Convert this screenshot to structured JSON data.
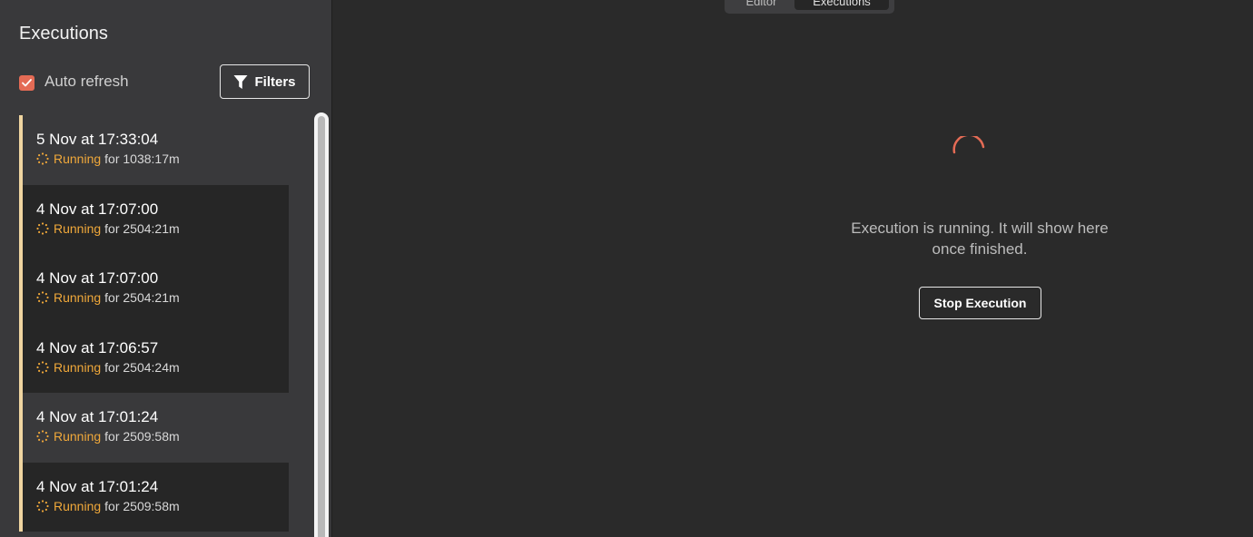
{
  "colors": {
    "accent": "#e46b55",
    "running": "#f0a83a",
    "running_bar": "#f0d5a0",
    "sidebar_bg": "#39393b",
    "main_bg": "#2a2a2a"
  },
  "header": {
    "tabs": [
      {
        "label": "Editor",
        "active": false
      },
      {
        "label": "Executions",
        "active": true
      }
    ]
  },
  "sidebar": {
    "title": "Executions",
    "auto_refresh": {
      "label": "Auto refresh",
      "checked": true
    },
    "filters_button": {
      "label": "Filters",
      "icon": "filter-icon"
    },
    "items": [
      {
        "title": "5 Nov at 17:33:04",
        "status": "Running",
        "duration": "for 1038:17m",
        "highlighted": true
      },
      {
        "title": "4 Nov at 17:07:00",
        "status": "Running",
        "duration": "for 2504:21m",
        "highlighted": false
      },
      {
        "title": "4 Nov at 17:07:00",
        "status": "Running",
        "duration": "for 2504:21m",
        "highlighted": false
      },
      {
        "title": "4 Nov at 17:06:57",
        "status": "Running",
        "duration": "for 2504:24m",
        "highlighted": false
      },
      {
        "title": "4 Nov at 17:01:24",
        "status": "Running",
        "duration": "for 2509:58m",
        "highlighted": true
      },
      {
        "title": "4 Nov at 17:01:24",
        "status": "Running",
        "duration": "for 2509:58m",
        "highlighted": false
      }
    ]
  },
  "main": {
    "message": "Execution is running. It will show here once finished.",
    "stop_button": "Stop Execution",
    "loader_icon": "spinner-icon"
  }
}
